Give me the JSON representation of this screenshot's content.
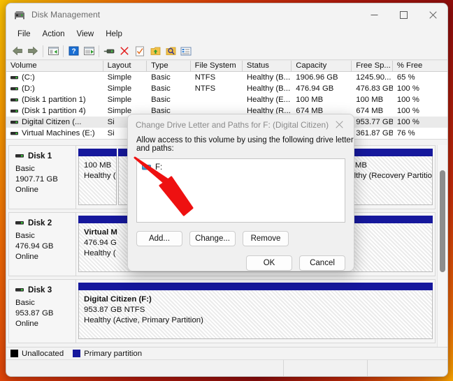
{
  "window": {
    "title": "Disk Management",
    "app_icon": "disk-management-icon",
    "minimize_label": "─",
    "maximize_label": "□",
    "close_label": "✕"
  },
  "menubar": {
    "items": [
      {
        "label": "File"
      },
      {
        "label": "Action"
      },
      {
        "label": "View"
      },
      {
        "label": "Help"
      }
    ]
  },
  "toolbar": {
    "buttons": [
      {
        "name": "back-icon",
        "tooltip": "Back"
      },
      {
        "name": "forward-icon",
        "tooltip": "Forward"
      },
      {
        "name": "up-one-level-icon",
        "tooltip": "Up one level"
      },
      {
        "name": "help-icon",
        "tooltip": "Help"
      },
      {
        "name": "show-hide-console-tree-icon",
        "tooltip": "Show/Hide Console Tree"
      },
      {
        "name": "properties-icon",
        "tooltip": "Properties"
      },
      {
        "name": "delete-icon",
        "tooltip": "Delete"
      },
      {
        "name": "format-icon",
        "tooltip": "Format"
      },
      {
        "name": "extend-volume-icon",
        "tooltip": "Extend Volume"
      },
      {
        "name": "rescan-disks-icon",
        "tooltip": "Rescan Disks"
      },
      {
        "name": "list-view-icon",
        "tooltip": "List View"
      }
    ]
  },
  "volume_list": {
    "columns": [
      {
        "label": "Volume",
        "cls": "c-vol"
      },
      {
        "label": "Layout",
        "cls": "c-lay"
      },
      {
        "label": "Type",
        "cls": "c-typ"
      },
      {
        "label": "File System",
        "cls": "c-fs"
      },
      {
        "label": "Status",
        "cls": "c-sta"
      },
      {
        "label": "Capacity",
        "cls": "c-cap"
      },
      {
        "label": "Free Sp...",
        "cls": "c-free"
      },
      {
        "label": "% Free",
        "cls": "c-pct"
      }
    ],
    "rows": [
      {
        "volume": " (C:)",
        "layout": "Simple",
        "type": "Basic",
        "file_system": "NTFS",
        "status": "Healthy (B...",
        "capacity": "1906.96 GB",
        "free": "1245.90...",
        "pct_free": "65 %",
        "selected": false
      },
      {
        "volume": " (D:)",
        "layout": "Simple",
        "type": "Basic",
        "file_system": "NTFS",
        "status": "Healthy (B...",
        "capacity": "476.94 GB",
        "free": "476.83 GB",
        "pct_free": "100 %",
        "selected": false
      },
      {
        "volume": "(Disk 1 partition 1)",
        "layout": "Simple",
        "type": "Basic",
        "file_system": "",
        "status": "Healthy (E...",
        "capacity": "100 MB",
        "free": "100 MB",
        "pct_free": "100 %",
        "selected": false
      },
      {
        "volume": "(Disk 1 partition 4)",
        "layout": "Simple",
        "type": "Basic",
        "file_system": "",
        "status": "Healthy (R...",
        "capacity": "674 MB",
        "free": "674 MB",
        "pct_free": "100 %",
        "selected": false
      },
      {
        "volume": "Digital Citizen (...",
        "layout": "Si",
        "type": "",
        "file_system": "",
        "status": "",
        "capacity": "953.77 GB",
        "free": "953.77 GB",
        "pct_free": "100 %",
        "selected": true
      },
      {
        "volume": "Virtual Machines (E:)",
        "layout": "Si",
        "type": "",
        "file_system": "",
        "status": "",
        "capacity": "361.87 GB",
        "free": "361.87 GB",
        "pct_free": "76 %",
        "selected": false
      }
    ]
  },
  "disks": [
    {
      "name": "Disk 1",
      "type": "Basic",
      "size": "1907.71 GB",
      "status": "Online",
      "partitions": [
        {
          "width_pct": 11,
          "title": "",
          "line2": "100 MB",
          "line3": "Healthy (",
          "hatched": true
        },
        {
          "width_pct": 64,
          "title": "",
          "line2": "",
          "line3": "",
          "hatched": true
        },
        {
          "width_pct": 25,
          "title": "",
          "line2": "674 MB",
          "line3": "Healthy (Recovery Partitio",
          "hatched": true
        }
      ]
    },
    {
      "name": "Disk 2",
      "type": "Basic",
      "size": "476.94 GB",
      "status": "Online",
      "partitions": [
        {
          "width_pct": 100,
          "title": "Virtual M",
          "line2": "476.94 G",
          "line3": "Healthy (",
          "hatched": true
        }
      ]
    },
    {
      "name": "Disk 3",
      "type": "Basic",
      "size": "953.87 GB",
      "status": "Online",
      "partitions": [
        {
          "width_pct": 100,
          "title": "Digital Citizen  (F:)",
          "line2": "953.87 GB NTFS",
          "line3": "Healthy (Active, Primary Partition)",
          "hatched": true
        }
      ]
    }
  ],
  "legend": [
    {
      "label": "Unallocated",
      "color": "#000000"
    },
    {
      "label": "Primary partition",
      "color": "#16189c"
    }
  ],
  "dialog": {
    "title": "Change Drive Letter and Paths for F: (Digital Citizen)",
    "close_label": "✕",
    "prompt": "Allow access to this volume by using the following drive letter and paths:",
    "list_items": [
      {
        "icon": "drive-icon",
        "label": "F:"
      }
    ],
    "buttons": {
      "add": "Add...",
      "change": "Change...",
      "remove": "Remove",
      "ok": "OK",
      "cancel": "Cancel"
    }
  },
  "colors": {
    "partition_bar": "#16189c",
    "accent_close": "#e81123",
    "annotation_arrow": "#ee1111",
    "desktop_gradient_start": "#f7c000",
    "desktop_gradient_end": "#8e0d0c"
  }
}
